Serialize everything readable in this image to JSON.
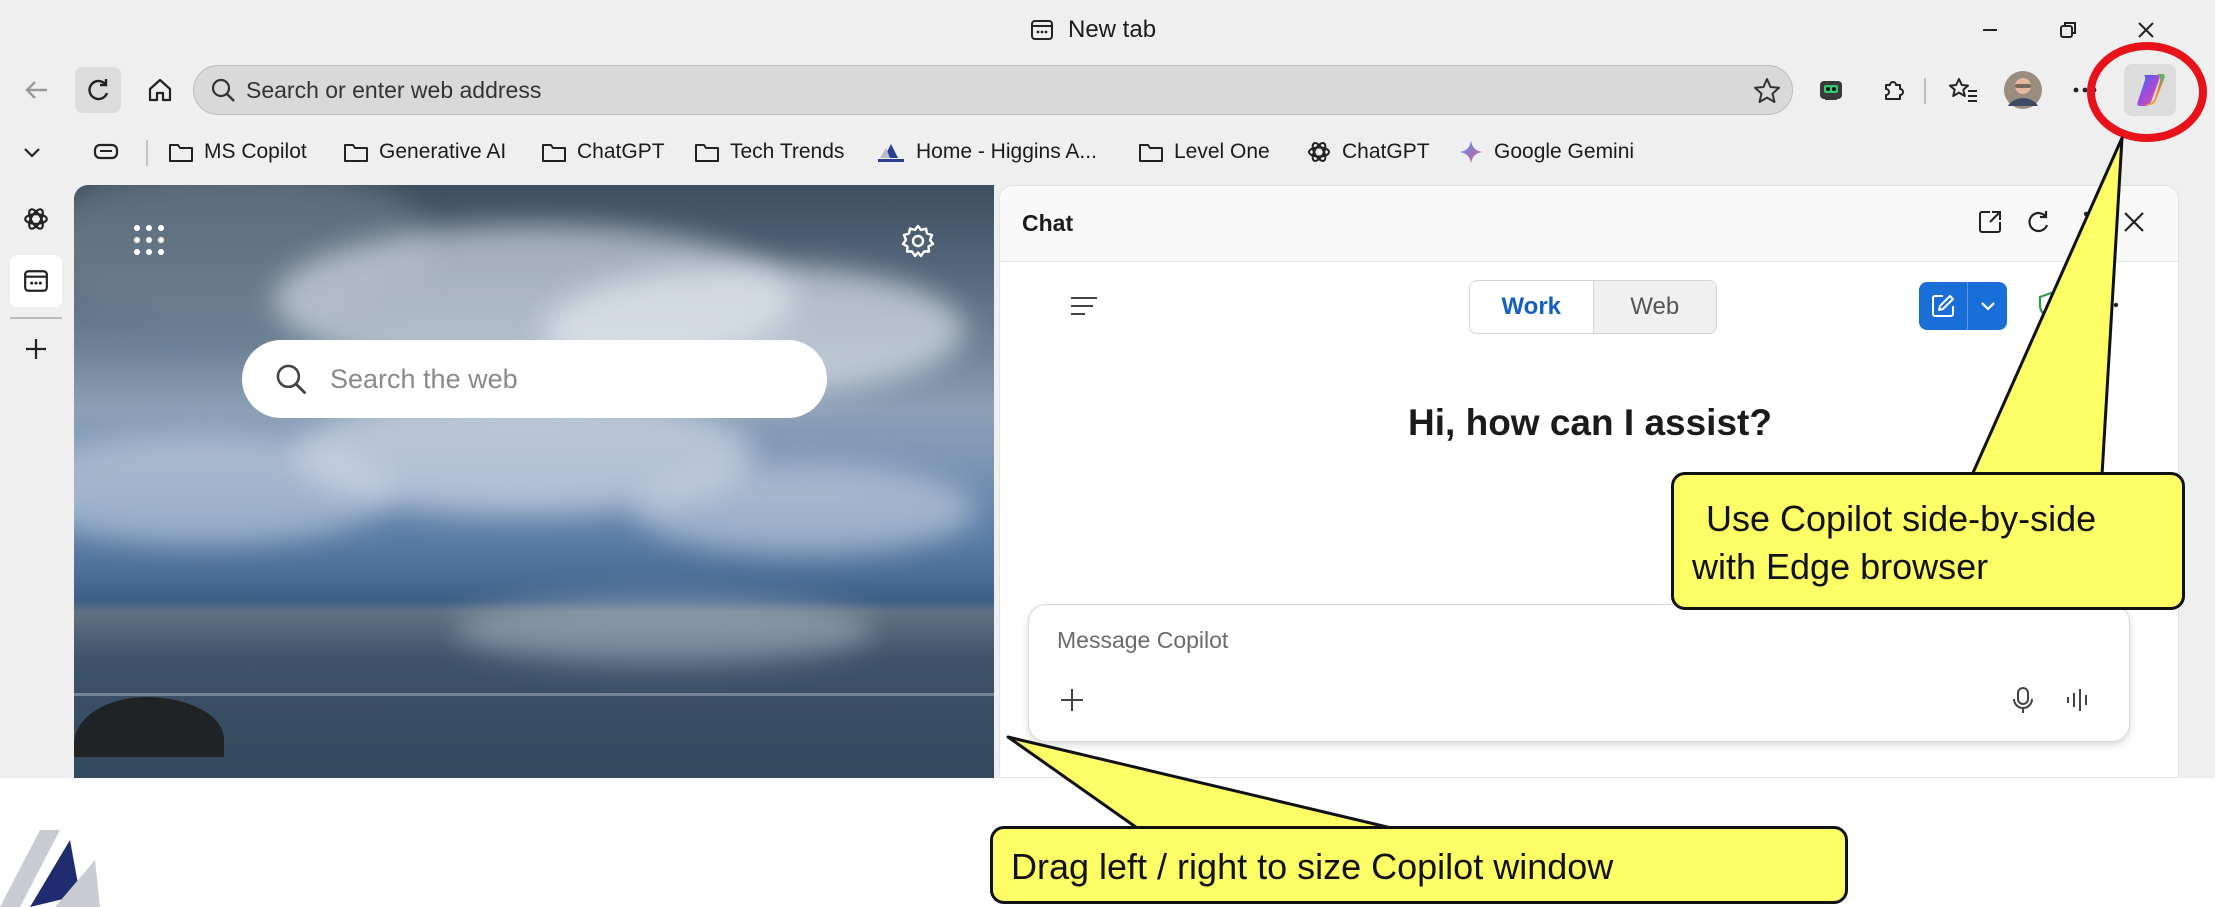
{
  "window": {
    "tab_title": "New tab"
  },
  "toolbar": {
    "address_placeholder": "Search or enter web address"
  },
  "favorites": [
    {
      "label": "MS Copilot",
      "icon": "folder-icon"
    },
    {
      "label": "Generative AI",
      "icon": "folder-icon"
    },
    {
      "label": "ChatGPT",
      "icon": "folder-icon"
    },
    {
      "label": "Tech Trends",
      "icon": "folder-icon"
    },
    {
      "label": "Home - Higgins A...",
      "icon": "higgins-logo-icon"
    },
    {
      "label": "Level One",
      "icon": "folder-icon"
    },
    {
      "label": "ChatGPT",
      "icon": "openai-icon"
    },
    {
      "label": "Google Gemini",
      "icon": "gemini-sparkle-icon"
    }
  ],
  "newtab": {
    "search_placeholder": "Search the web"
  },
  "copilot": {
    "pane_title": "Chat",
    "mode_work": "Work",
    "mode_web": "Web",
    "greeting": "Hi, how can I assist?",
    "message_placeholder": "Message Copilot"
  },
  "annotations": {
    "callout_copilot_line1": "Use Copilot side-by-side",
    "callout_copilot_line2": "with Edge browser",
    "callout_drag": "Drag left / right to size Copilot window"
  },
  "colors": {
    "callout_fill": "#fdfd66",
    "highlight_ring": "#e8121a",
    "copilot_accent": "#1a6ed8",
    "work_text": "#1460c2"
  }
}
